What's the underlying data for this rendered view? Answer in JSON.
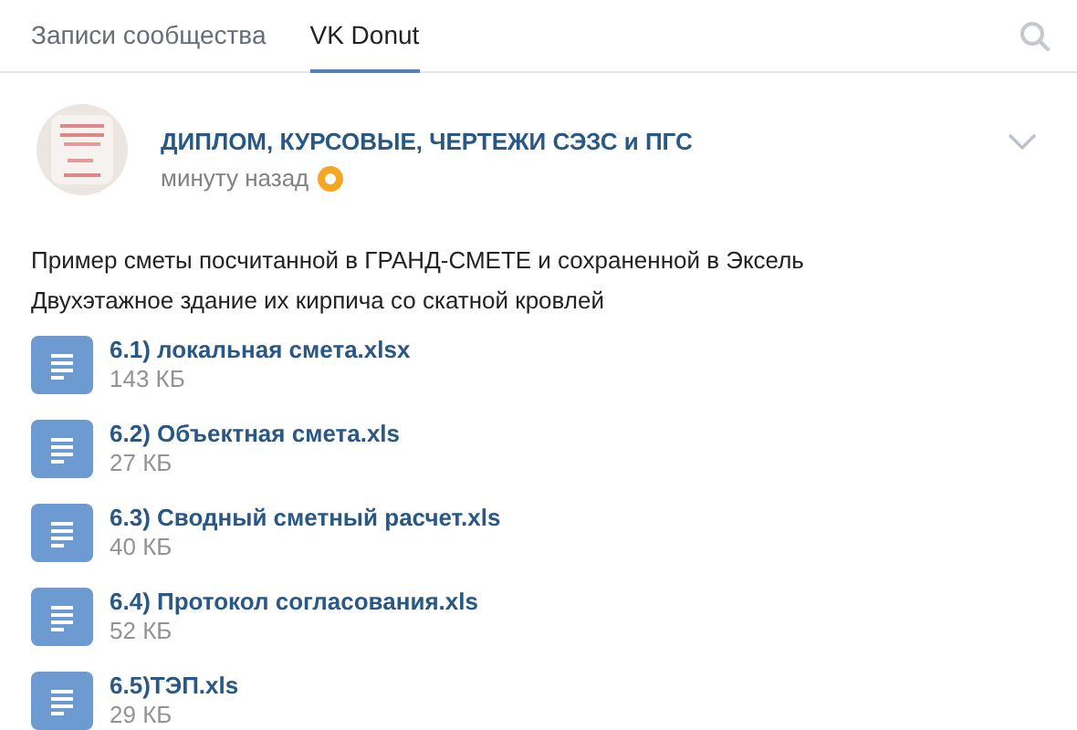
{
  "tabs": [
    {
      "label": "Записи сообщества",
      "selected": false
    },
    {
      "label": "VK Donut",
      "selected": true
    }
  ],
  "post": {
    "author": "ДИПЛОМ, КУРСОВЫЕ, ЧЕРТЕЖИ СЭЗС и ПГС",
    "time": "минуту назад",
    "donut": true,
    "text": [
      "Пример сметы посчитанной в ГРАНД-СМЕТЕ и сохраненной в Эксель",
      "Двухэтажное здание их кирпича со скатной кровлей"
    ],
    "files": [
      {
        "name": "6.1) локальная смета.xlsx",
        "size": "143 КБ"
      },
      {
        "name": "6.2) Объектная смета.xls",
        "size": "27 КБ"
      },
      {
        "name": "6.3) Сводный сметный расчет.xls",
        "size": "40 КБ"
      },
      {
        "name": "6.4) Протокол согласования.xls",
        "size": "52 КБ"
      },
      {
        "name": "6.5)ТЭП.xls",
        "size": "29 КБ"
      }
    ]
  }
}
